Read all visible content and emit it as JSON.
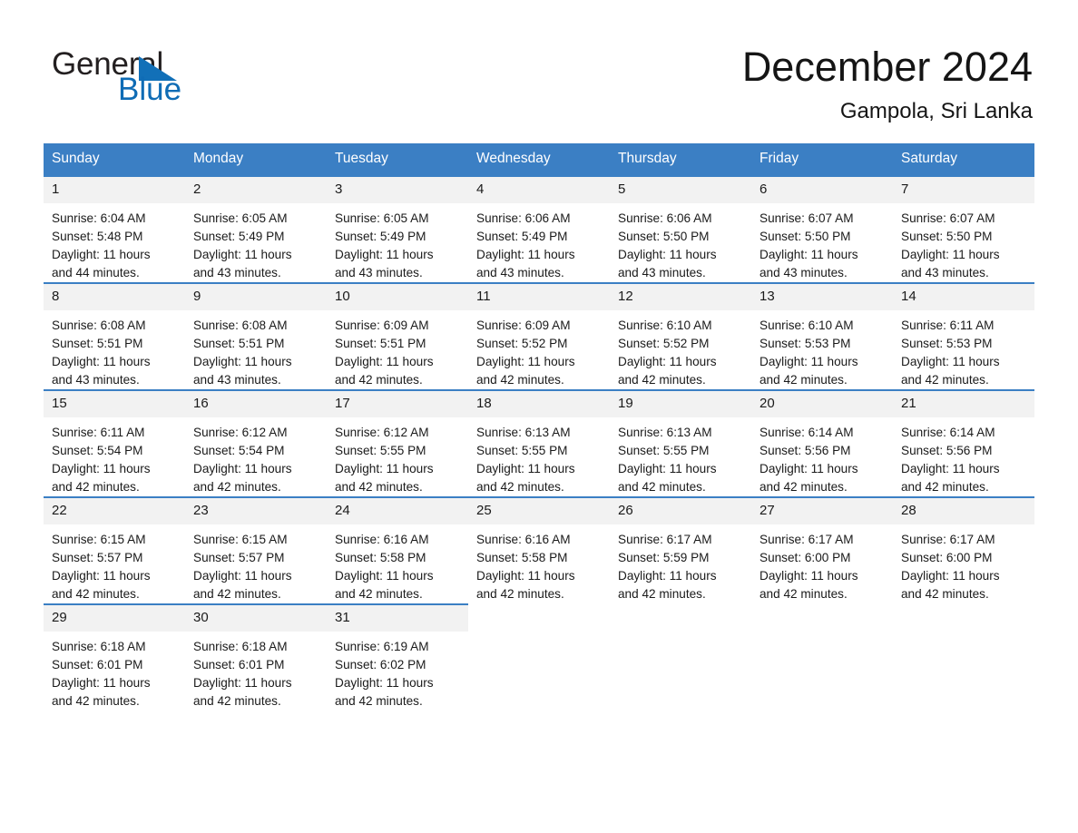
{
  "brand": {
    "name_part1": "General",
    "name_part2": "Blue",
    "accent_color": "#1270b8"
  },
  "header": {
    "title": "December 2024",
    "location": "Gampola, Sri Lanka"
  },
  "calendar": {
    "header_color": "#3b7fc4",
    "daynum_band_color": "#f2f2f2",
    "weekday_names": [
      "Sunday",
      "Monday",
      "Tuesday",
      "Wednesday",
      "Thursday",
      "Friday",
      "Saturday"
    ],
    "labels": {
      "sunrise": "Sunrise:",
      "sunset": "Sunset:",
      "daylight": "Daylight:"
    },
    "weeks": [
      [
        {
          "day": "1",
          "sunrise": "Sunrise: 6:04 AM",
          "sunset": "Sunset: 5:48 PM",
          "daylight_line1": "Daylight: 11 hours",
          "daylight_line2": "and 44 minutes."
        },
        {
          "day": "2",
          "sunrise": "Sunrise: 6:05 AM",
          "sunset": "Sunset: 5:49 PM",
          "daylight_line1": "Daylight: 11 hours",
          "daylight_line2": "and 43 minutes."
        },
        {
          "day": "3",
          "sunrise": "Sunrise: 6:05 AM",
          "sunset": "Sunset: 5:49 PM",
          "daylight_line1": "Daylight: 11 hours",
          "daylight_line2": "and 43 minutes."
        },
        {
          "day": "4",
          "sunrise": "Sunrise: 6:06 AM",
          "sunset": "Sunset: 5:49 PM",
          "daylight_line1": "Daylight: 11 hours",
          "daylight_line2": "and 43 minutes."
        },
        {
          "day": "5",
          "sunrise": "Sunrise: 6:06 AM",
          "sunset": "Sunset: 5:50 PM",
          "daylight_line1": "Daylight: 11 hours",
          "daylight_line2": "and 43 minutes."
        },
        {
          "day": "6",
          "sunrise": "Sunrise: 6:07 AM",
          "sunset": "Sunset: 5:50 PM",
          "daylight_line1": "Daylight: 11 hours",
          "daylight_line2": "and 43 minutes."
        },
        {
          "day": "7",
          "sunrise": "Sunrise: 6:07 AM",
          "sunset": "Sunset: 5:50 PM",
          "daylight_line1": "Daylight: 11 hours",
          "daylight_line2": "and 43 minutes."
        }
      ],
      [
        {
          "day": "8",
          "sunrise": "Sunrise: 6:08 AM",
          "sunset": "Sunset: 5:51 PM",
          "daylight_line1": "Daylight: 11 hours",
          "daylight_line2": "and 43 minutes."
        },
        {
          "day": "9",
          "sunrise": "Sunrise: 6:08 AM",
          "sunset": "Sunset: 5:51 PM",
          "daylight_line1": "Daylight: 11 hours",
          "daylight_line2": "and 43 minutes."
        },
        {
          "day": "10",
          "sunrise": "Sunrise: 6:09 AM",
          "sunset": "Sunset: 5:51 PM",
          "daylight_line1": "Daylight: 11 hours",
          "daylight_line2": "and 42 minutes."
        },
        {
          "day": "11",
          "sunrise": "Sunrise: 6:09 AM",
          "sunset": "Sunset: 5:52 PM",
          "daylight_line1": "Daylight: 11 hours",
          "daylight_line2": "and 42 minutes."
        },
        {
          "day": "12",
          "sunrise": "Sunrise: 6:10 AM",
          "sunset": "Sunset: 5:52 PM",
          "daylight_line1": "Daylight: 11 hours",
          "daylight_line2": "and 42 minutes."
        },
        {
          "day": "13",
          "sunrise": "Sunrise: 6:10 AM",
          "sunset": "Sunset: 5:53 PM",
          "daylight_line1": "Daylight: 11 hours",
          "daylight_line2": "and 42 minutes."
        },
        {
          "day": "14",
          "sunrise": "Sunrise: 6:11 AM",
          "sunset": "Sunset: 5:53 PM",
          "daylight_line1": "Daylight: 11 hours",
          "daylight_line2": "and 42 minutes."
        }
      ],
      [
        {
          "day": "15",
          "sunrise": "Sunrise: 6:11 AM",
          "sunset": "Sunset: 5:54 PM",
          "daylight_line1": "Daylight: 11 hours",
          "daylight_line2": "and 42 minutes."
        },
        {
          "day": "16",
          "sunrise": "Sunrise: 6:12 AM",
          "sunset": "Sunset: 5:54 PM",
          "daylight_line1": "Daylight: 11 hours",
          "daylight_line2": "and 42 minutes."
        },
        {
          "day": "17",
          "sunrise": "Sunrise: 6:12 AM",
          "sunset": "Sunset: 5:55 PM",
          "daylight_line1": "Daylight: 11 hours",
          "daylight_line2": "and 42 minutes."
        },
        {
          "day": "18",
          "sunrise": "Sunrise: 6:13 AM",
          "sunset": "Sunset: 5:55 PM",
          "daylight_line1": "Daylight: 11 hours",
          "daylight_line2": "and 42 minutes."
        },
        {
          "day": "19",
          "sunrise": "Sunrise: 6:13 AM",
          "sunset": "Sunset: 5:55 PM",
          "daylight_line1": "Daylight: 11 hours",
          "daylight_line2": "and 42 minutes."
        },
        {
          "day": "20",
          "sunrise": "Sunrise: 6:14 AM",
          "sunset": "Sunset: 5:56 PM",
          "daylight_line1": "Daylight: 11 hours",
          "daylight_line2": "and 42 minutes."
        },
        {
          "day": "21",
          "sunrise": "Sunrise: 6:14 AM",
          "sunset": "Sunset: 5:56 PM",
          "daylight_line1": "Daylight: 11 hours",
          "daylight_line2": "and 42 minutes."
        }
      ],
      [
        {
          "day": "22",
          "sunrise": "Sunrise: 6:15 AM",
          "sunset": "Sunset: 5:57 PM",
          "daylight_line1": "Daylight: 11 hours",
          "daylight_line2": "and 42 minutes."
        },
        {
          "day": "23",
          "sunrise": "Sunrise: 6:15 AM",
          "sunset": "Sunset: 5:57 PM",
          "daylight_line1": "Daylight: 11 hours",
          "daylight_line2": "and 42 minutes."
        },
        {
          "day": "24",
          "sunrise": "Sunrise: 6:16 AM",
          "sunset": "Sunset: 5:58 PM",
          "daylight_line1": "Daylight: 11 hours",
          "daylight_line2": "and 42 minutes."
        },
        {
          "day": "25",
          "sunrise": "Sunrise: 6:16 AM",
          "sunset": "Sunset: 5:58 PM",
          "daylight_line1": "Daylight: 11 hours",
          "daylight_line2": "and 42 minutes."
        },
        {
          "day": "26",
          "sunrise": "Sunrise: 6:17 AM",
          "sunset": "Sunset: 5:59 PM",
          "daylight_line1": "Daylight: 11 hours",
          "daylight_line2": "and 42 minutes."
        },
        {
          "day": "27",
          "sunrise": "Sunrise: 6:17 AM",
          "sunset": "Sunset: 6:00 PM",
          "daylight_line1": "Daylight: 11 hours",
          "daylight_line2": "and 42 minutes."
        },
        {
          "day": "28",
          "sunrise": "Sunrise: 6:17 AM",
          "sunset": "Sunset: 6:00 PM",
          "daylight_line1": "Daylight: 11 hours",
          "daylight_line2": "and 42 minutes."
        }
      ],
      [
        {
          "day": "29",
          "sunrise": "Sunrise: 6:18 AM",
          "sunset": "Sunset: 6:01 PM",
          "daylight_line1": "Daylight: 11 hours",
          "daylight_line2": "and 42 minutes."
        },
        {
          "day": "30",
          "sunrise": "Sunrise: 6:18 AM",
          "sunset": "Sunset: 6:01 PM",
          "daylight_line1": "Daylight: 11 hours",
          "daylight_line2": "and 42 minutes."
        },
        {
          "day": "31",
          "sunrise": "Sunrise: 6:19 AM",
          "sunset": "Sunset: 6:02 PM",
          "daylight_line1": "Daylight: 11 hours",
          "daylight_line2": "and 42 minutes."
        },
        {
          "day": "",
          "sunrise": "",
          "sunset": "",
          "daylight_line1": "",
          "daylight_line2": "",
          "empty": true
        },
        {
          "day": "",
          "sunrise": "",
          "sunset": "",
          "daylight_line1": "",
          "daylight_line2": "",
          "empty": true
        },
        {
          "day": "",
          "sunrise": "",
          "sunset": "",
          "daylight_line1": "",
          "daylight_line2": "",
          "empty": true
        },
        {
          "day": "",
          "sunrise": "",
          "sunset": "",
          "daylight_line1": "",
          "daylight_line2": "",
          "empty": true
        }
      ]
    ]
  }
}
